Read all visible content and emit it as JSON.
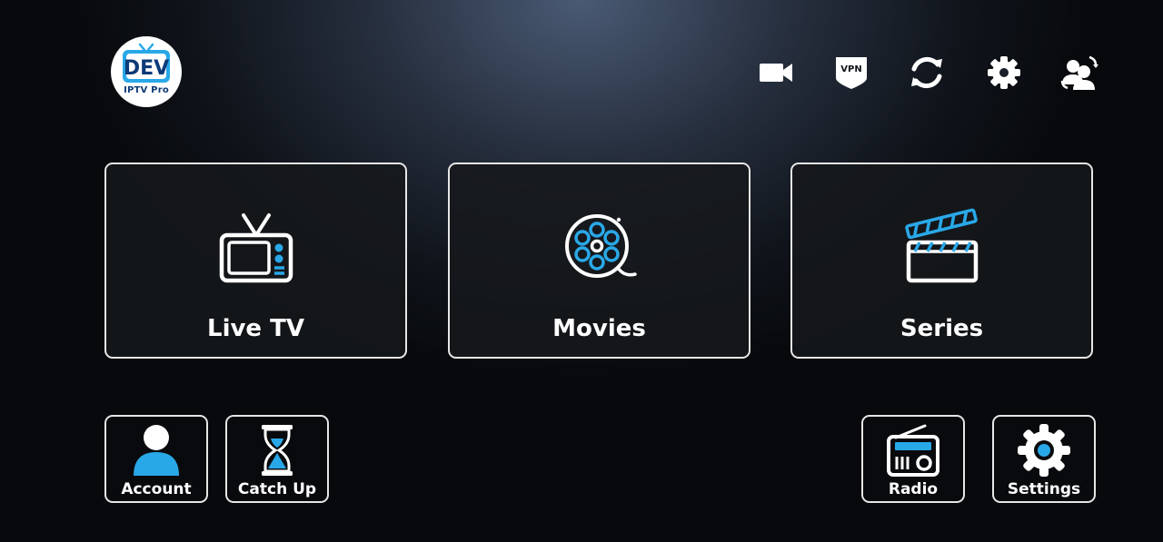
{
  "logo": {
    "main": "DEV",
    "sub": "IPTV Pro"
  },
  "top_icons": [
    "video-camera-icon",
    "vpn-shield-icon",
    "refresh-icon",
    "gear-icon",
    "switch-user-icon"
  ],
  "vpn_label": "VPN",
  "tiles": [
    {
      "label": "Live TV",
      "icon": "tv-icon"
    },
    {
      "label": "Movies",
      "icon": "film-reel-icon"
    },
    {
      "label": "Series",
      "icon": "clapperboard-icon"
    }
  ],
  "small_buttons": [
    {
      "label": "Account",
      "icon": "user-icon"
    },
    {
      "label": "Catch Up",
      "icon": "hourglass-icon"
    },
    {
      "label": "Radio",
      "icon": "radio-icon"
    },
    {
      "label": "Settings",
      "icon": "gear-icon"
    }
  ],
  "colors": {
    "accent": "#29a8e8",
    "border": "#e6e6e6",
    "logo_blue": "#0d3a78"
  }
}
